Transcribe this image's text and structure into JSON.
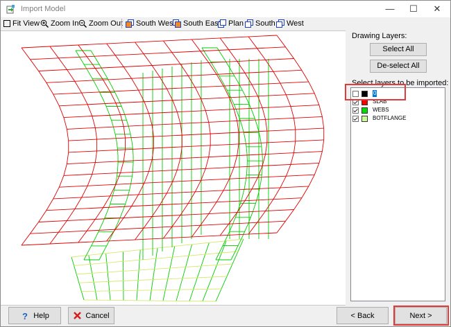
{
  "window": {
    "title": "Import Model",
    "icon": "import-model-icon",
    "controls": [
      "minimize-icon",
      "maximize-icon",
      "close-icon"
    ]
  },
  "toolbar": {
    "fit_view": "Fit View",
    "zoom_in": "Zoom In",
    "zoom_out": "Zoom Out",
    "south_west": "South West",
    "south_east": "South East",
    "plan": "Plan",
    "south": "South",
    "west": "West"
  },
  "panel": {
    "drawing_layers_label": "Drawing Layers:",
    "select_all": "Select All",
    "deselect_all": "De-select All",
    "select_layers_label": "Select layers to be imported:",
    "layers": [
      {
        "name": "0",
        "checked": false,
        "color": "#000000",
        "selected": true
      },
      {
        "name": "SLAB",
        "checked": true,
        "color": "#ff0000",
        "selected": false
      },
      {
        "name": "WEBS",
        "checked": true,
        "color": "#00dd00",
        "selected": false
      },
      {
        "name": "BOTFLANGE",
        "checked": true,
        "color": "#ccff99",
        "selected": false
      }
    ]
  },
  "footer": {
    "help": "Help",
    "cancel": "Cancel",
    "back": "< Back",
    "next": "Next >"
  },
  "colors": {
    "slab": "#e00000",
    "webs": "#00cc00",
    "botflange": "#d6e86a",
    "highlight": "#e03a3a"
  }
}
